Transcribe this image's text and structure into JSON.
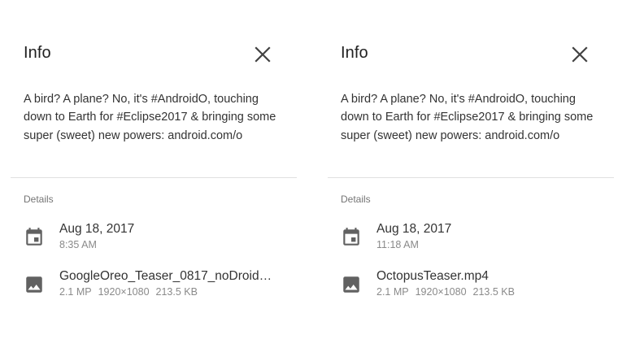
{
  "panels": [
    {
      "title": "Info",
      "description": "A bird? A plane? No, it's #AndroidO, touching down to Earth for #Eclipse2017 & bringing some super (sweet) new powers: android.com/o",
      "section_label": "Details",
      "date": "Aug 18, 2017",
      "time": "8:35 AM",
      "file_name": "GoogleOreo_Teaser_0817_noDroid…",
      "megapixels": "2.1 MP",
      "resolution": "1920×1080",
      "file_size": "213.5 KB"
    },
    {
      "title": "Info",
      "description": "A bird? A plane? No, it's #AndroidO, touching down to Earth for #Eclipse2017 & bringing some super (sweet) new powers: android.com/o",
      "section_label": "Details",
      "date": "Aug 18, 2017",
      "time": "11:18 AM",
      "file_name": "OctopusTeaser.mp4",
      "megapixels": "2.1 MP",
      "resolution": "1920×1080",
      "file_size": "213.5 KB"
    }
  ],
  "icons": {
    "close": "close-icon",
    "date": "calendar-icon",
    "file": "image-icon"
  },
  "colors": {
    "title": "#212121",
    "icon": "#616161",
    "divider": "#e0e0e0",
    "secondary_text": "#8a8a8a"
  }
}
